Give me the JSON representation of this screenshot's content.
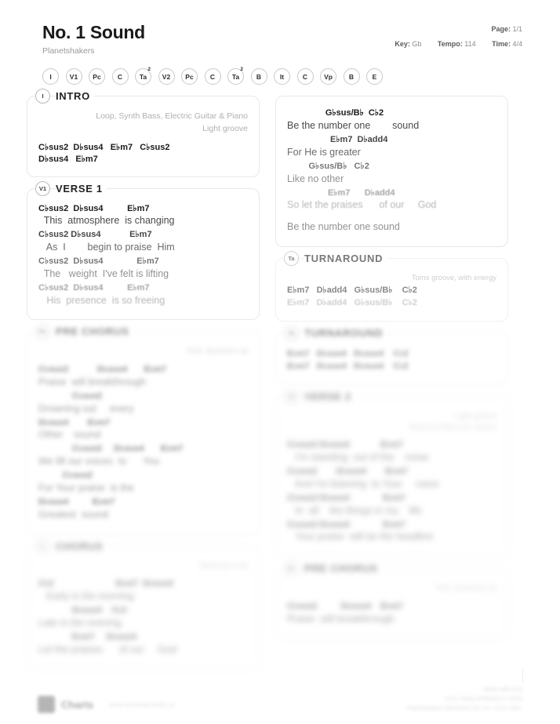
{
  "header": {
    "title": "No. 1 Sound",
    "artist": "Planetshakers",
    "page_label": "Page:",
    "page_value": "1/1",
    "key_label": "Key:",
    "key_value": "Gb",
    "tempo_label": "Tempo:",
    "tempo_value": "114",
    "time_label": "Time:",
    "time_value": "4/4"
  },
  "chips": [
    {
      "label": "I",
      "sup": ""
    },
    {
      "label": "V1",
      "sup": ""
    },
    {
      "label": "Pc",
      "sup": ""
    },
    {
      "label": "C",
      "sup": ""
    },
    {
      "label": "Ta",
      "sup": "2"
    },
    {
      "label": "V2",
      "sup": ""
    },
    {
      "label": "Pc",
      "sup": ""
    },
    {
      "label": "C",
      "sup": ""
    },
    {
      "label": "Ta",
      "sup": "2"
    },
    {
      "label": "B",
      "sup": ""
    },
    {
      "label": "It",
      "sup": ""
    },
    {
      "label": "C",
      "sup": ""
    },
    {
      "label": "Vp",
      "sup": ""
    },
    {
      "label": "B",
      "sup": ""
    },
    {
      "label": "E",
      "sup": ""
    }
  ],
  "intro": {
    "badge": "I",
    "name": "INTRO",
    "note1": "Loop, Synth Bass, Electric Guitar & Piano",
    "note2": "Light groove",
    "chords1": "C♭sus2  D♭sus4   E♭m7   C♭sus2",
    "chords2": "D♭sus4   E♭m7"
  },
  "verse1": {
    "badge": "V1",
    "name": "VERSE 1",
    "lines": [
      {
        "chords": "C♭sus2  D♭sus4          E♭m7",
        "lyrics": "  This  atmosphere  is changing"
      },
      {
        "chords": "C♭sus2 D♭sus4            E♭m7",
        "lyrics": "   As  I        begin to praise  Him"
      },
      {
        "chords": "C♭sus2  D♭sus4              E♭m7",
        "lyrics": "  The   weight  I've felt is lifting"
      },
      {
        "chords": "C♭sus2  D♭sus4          E♭m7",
        "lyrics": "   His  presence  is so freeing"
      }
    ]
  },
  "chorus_cont": {
    "lines": [
      {
        "chords": "                G♭sus/B♭  C♭2",
        "lyrics": "Be the number one        sound"
      },
      {
        "chords": "                  E♭m7  D♭add4",
        "lyrics": "For He is greater"
      },
      {
        "chords": "         G♭sus/B♭   C♭2",
        "lyrics": "Like no other"
      },
      {
        "chords": "                 E♭m7      D♭add4",
        "lyrics": "So let the praises      of our     God"
      }
    ],
    "tail": "Be the number one sound"
  },
  "turnaround": {
    "badge": "Ta",
    "name": "TURNAROUND",
    "note": "Toms groove, with energy",
    "row1": "E♭m7   D♭add4   G♭sus/B♭    C♭2",
    "row2": "E♭m7   D♭add4   G♭sus/B♭    C♭2"
  },
  "pre_chorus_left": {
    "badge": "Pc",
    "name": "PRE CHORUS",
    "note": "Kick, dynamics up",
    "lines": [
      {
        "chords": "C♭sus2            D♭sus4       E♭m7",
        "lyrics": "Praise  will breakthrough"
      },
      {
        "chords": "              C♭sus2",
        "lyrics": "Drowning out     every"
      },
      {
        "chords": "D♭sus4        E♭m7",
        "lyrics": "Other    sound"
      },
      {
        "chords": "              C♭sus2     D♭sus4       E♭m7",
        "lyrics": "We lift our voices  to      You"
      },
      {
        "chords": "          C♭sus2",
        "lyrics": "For Your praise  is the"
      },
      {
        "chords": "D♭sus4          E♭m7",
        "lyrics": "Greatest  sound"
      }
    ]
  },
  "chorus_left": {
    "badge": "C",
    "name": "CHORUS",
    "note": "Band up in full",
    "lines": [
      {
        "chords": "C♭2                          E♭m7  D♭sus4",
        "lyrics": "   Early in the morning"
      },
      {
        "chords": "              D♭sus4    C♭2",
        "lyrics": "Late in the evening"
      },
      {
        "chords": "              E♭m7     D♭sus4",
        "lyrics": "Let the praises      of our     God"
      }
    ]
  },
  "turnaround2_right": {
    "badge": "Ta",
    "name": "TURNAROUND",
    "row1": "E♭m7   D♭sus4   D♭sus4    C♭2",
    "row2": "E♭m7   D♭sus4   D♭sus4    C♭2"
  },
  "verse2_right": {
    "badge": "V2",
    "name": "VERSE 2",
    "note1": "Light groove",
    "note2": "Drums & Bass out, sparse",
    "lines": [
      {
        "chords": "C♭sus2 D♭sus4             E♭m7",
        "lyrics": "   I'm standing  out of the    noise"
      },
      {
        "chords": "C♭sus2        D♭sus4        E♭m7",
        "lyrics": "   And I'm listening  to Your     voice"
      },
      {
        "chords": "C♭sus2 D♭sus4              E♭m7",
        "lyrics": "   In  all    the things in my    life"
      },
      {
        "chords": "C♭sus2 D♭sus4              E♭m7",
        "lyrics": "   Your praise  will be the headline"
      }
    ]
  },
  "pre_chorus_right": {
    "badge": "Pc",
    "name": "PRE CHORUS",
    "note": "Kick, dynamics up",
    "lines": [
      {
        "chords": "C♭sus2          D♭sus4    E♭m7",
        "lyrics": "Praise  will breakthrough"
      }
    ]
  },
  "footer": {
    "brand_name": "Charts",
    "brand_url": "www.worshipcharts.co",
    "copy1": "Made with love",
    "copy2": "CCLI Song #7065432  © 2016",
    "copy3": "Planetshakers Ministries Intl. Inc.    CCLI  1827"
  }
}
